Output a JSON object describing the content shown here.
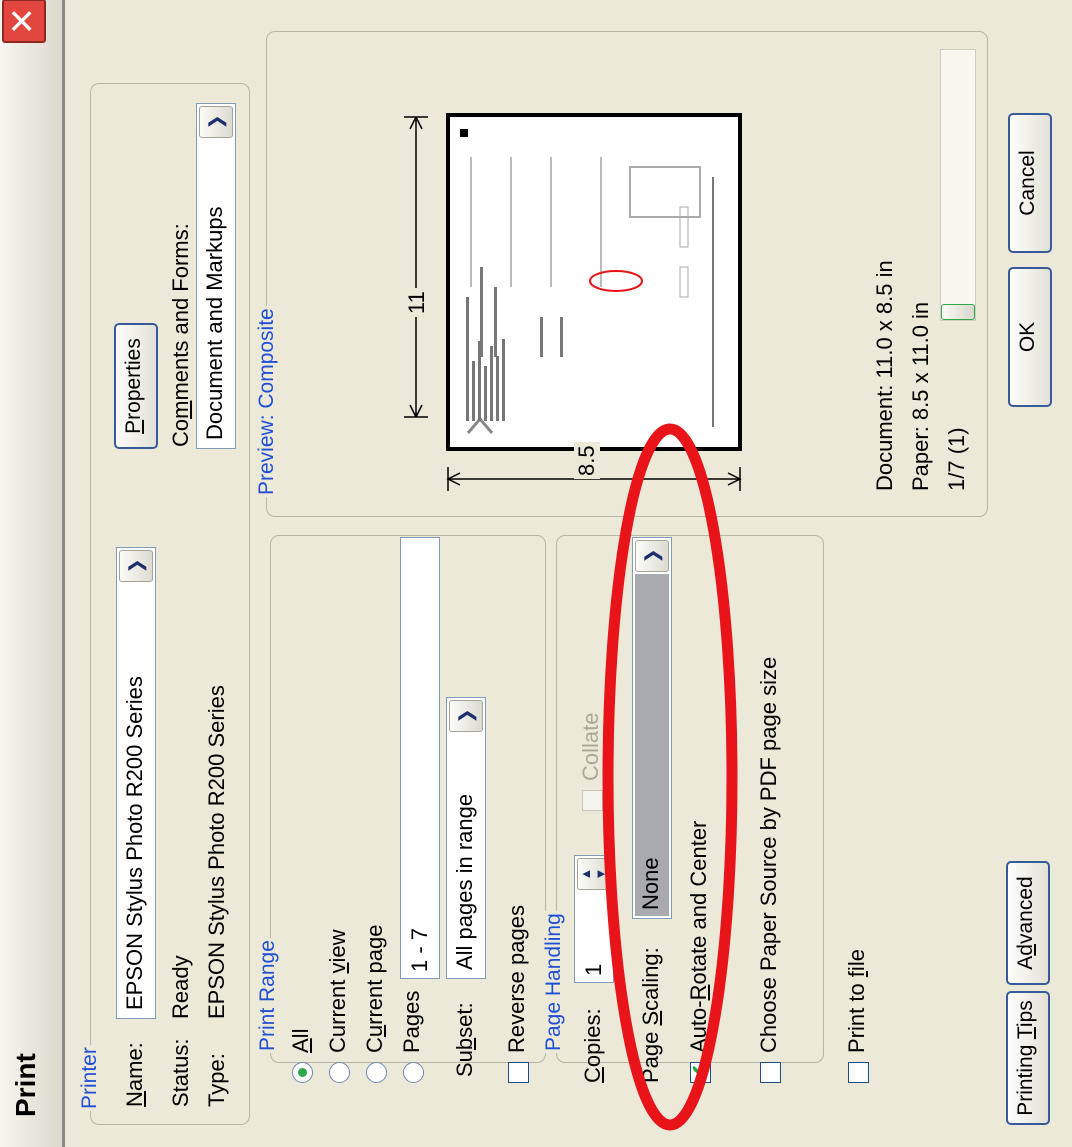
{
  "window": {
    "title": "Print"
  },
  "printer": {
    "group_title": "Printer",
    "name_label_pre": "",
    "name_label_u": "N",
    "name_label_post": "ame:",
    "name_value": "EPSON Stylus Photo R200 Series",
    "status_label": "Status:",
    "status_value": "Ready",
    "type_label": "Type:",
    "type_value": "EPSON Stylus Photo R200 Series",
    "properties_pre": "",
    "properties_u": "P",
    "properties_post": "roperties",
    "comments_pre": "Co",
    "comments_u": "m",
    "comments_post": "ments and Forms:",
    "comments_value": "Document and Markups"
  },
  "print_range": {
    "group_title": "Print Range",
    "all_u": "A",
    "all_post": "ll",
    "current_view_pre": "Current ",
    "current_view_u": "v",
    "current_view_post": "iew",
    "current_page_pre": "C",
    "current_page_u": "u",
    "current_page_post": "rrent page",
    "pages_label": "Pages",
    "pages_value": "1 - 7",
    "subset_pre": "Su",
    "subset_u": "b",
    "subset_post": "set:",
    "subset_value": "All pages in range",
    "reverse_label": "Reverse pages"
  },
  "page_handling": {
    "group_title": "Page Handling",
    "copies_u": "C",
    "copies_post": "opies:",
    "copies_value": "1",
    "collate_label": "Collate",
    "scaling_pre": "Page ",
    "scaling_u": "S",
    "scaling_post": "caling:",
    "scaling_value": "None",
    "autorotate_pre": "Auto-",
    "autorotate_u": "R",
    "autorotate_post": "otate and Center",
    "choose_source_label": "Choose Paper Source by PDF page size",
    "print_to_file_pre": "Print to ",
    "print_to_file_u": "f",
    "print_to_file_post": "ile"
  },
  "preview": {
    "group_title": "Preview: Composite",
    "height_dim": "11",
    "width_dim": "8.5",
    "document_size": "Document: 11.0 x 8.5 in",
    "paper_size": "Paper: 8.5 x 11.0 in",
    "page_indicator": "1/7 (1)"
  },
  "buttons": {
    "printing_tips_pre": "Printing ",
    "printing_tips_u": "T",
    "printing_tips_post": "ips",
    "advanced_pre": "A",
    "advanced_u": "d",
    "advanced_post": "vanced",
    "ok": "OK",
    "cancel": "Cancel"
  },
  "colors": {
    "accent": "#1f4fd6",
    "highlight_ellipse": "#e8141a",
    "dialog_bg": "#ece9d8",
    "check_green": "#2da84a"
  }
}
